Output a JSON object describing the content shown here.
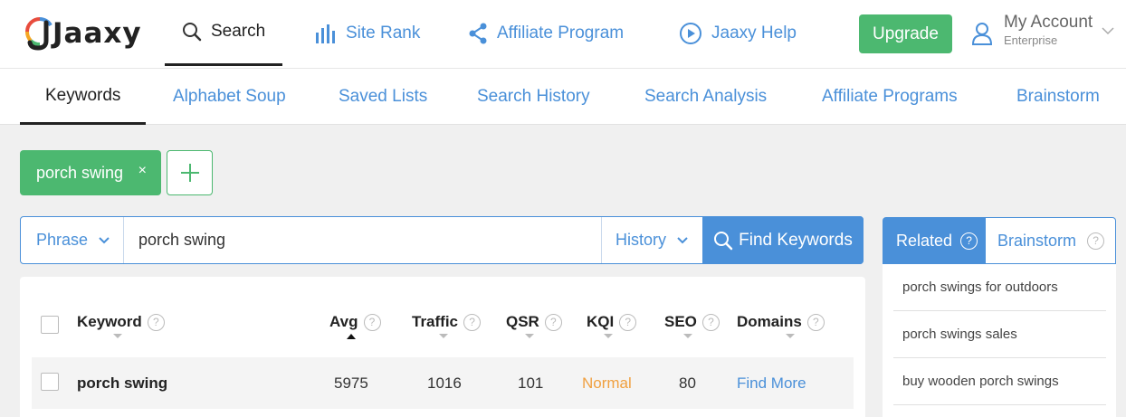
{
  "brand": {
    "name": "Jaaxy"
  },
  "topnav": {
    "search": "Search",
    "site_rank": "Site Rank",
    "affiliate_program": "Affiliate Program",
    "help": "Jaaxy Help",
    "upgrade": "Upgrade",
    "account_name": "My Account",
    "account_plan": "Enterprise"
  },
  "subnav": {
    "keywords": "Keywords",
    "alphabet_soup": "Alphabet Soup",
    "saved_lists": "Saved Lists",
    "search_history": "Search History",
    "search_analysis": "Search Analysis",
    "affiliate_programs": "Affiliate Programs",
    "brainstorm": "Brainstorm"
  },
  "chip": {
    "label": "porch swing",
    "close": "×"
  },
  "search": {
    "mode": "Phrase",
    "query": "porch swing",
    "history": "History",
    "find": "Find Keywords"
  },
  "table": {
    "columns": {
      "keyword": "Keyword",
      "avg": "Avg",
      "traffic": "Traffic",
      "qsr": "QSR",
      "kqi": "KQI",
      "seo": "SEO",
      "domains": "Domains"
    },
    "help_glyph": "?",
    "rows": [
      {
        "keyword": "porch swing",
        "avg": "5975",
        "traffic": "1016",
        "qsr": "101",
        "kqi": "Normal",
        "seo": "80",
        "domains": "Find More"
      }
    ]
  },
  "related_panel": {
    "tab_related": "Related",
    "tab_brainstorm": "Brainstorm",
    "items": [
      "porch swings for outdoors",
      "porch swings sales",
      "buy wooden porch swings"
    ]
  },
  "colors": {
    "accent_blue": "#4a90d9",
    "accent_green": "#4cb870",
    "kqi_normal": "#f0a040"
  }
}
